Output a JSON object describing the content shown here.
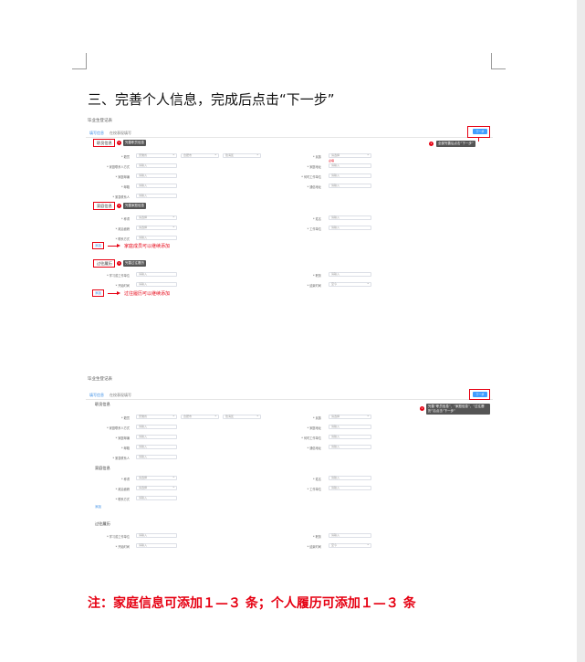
{
  "heading": "三、完善个人信息，完成后点击“下一步”",
  "note": "注：家庭信息可添加１—３ 条；个人履历可添加１—３ 条",
  "shot1": {
    "title": "毕业生登记表",
    "tab_active": "填写信息",
    "tab_other": "在校表现填写",
    "next_button": "下一步",
    "section_basic": "职员信息",
    "section_family": "家庭信息",
    "section_history": "过往履历",
    "tip_basic": "完善职员信息",
    "tip_family": "完善家庭信息",
    "tip_history": "完善过往履历",
    "tip_next": "全部完善后点击“下一步”",
    "add_family": "添加",
    "add_history": "添加",
    "family_note": "家庭成员可以继续添加",
    "history_note": "过往履历可以继续添加",
    "marker": "1"
  },
  "shot2": {
    "title": "毕业生登记表",
    "tab_active": "填写信息",
    "tab_other": "在校表现填写",
    "next_button": "下一步",
    "section_basic": "职员信息",
    "section_family": "家庭信息",
    "section_history": "过往履历",
    "tip_next": "完善“职员信息”、“家庭信息”、“过往履历”后点击“下一步”",
    "add_family": "添加",
    "marker": "1"
  }
}
